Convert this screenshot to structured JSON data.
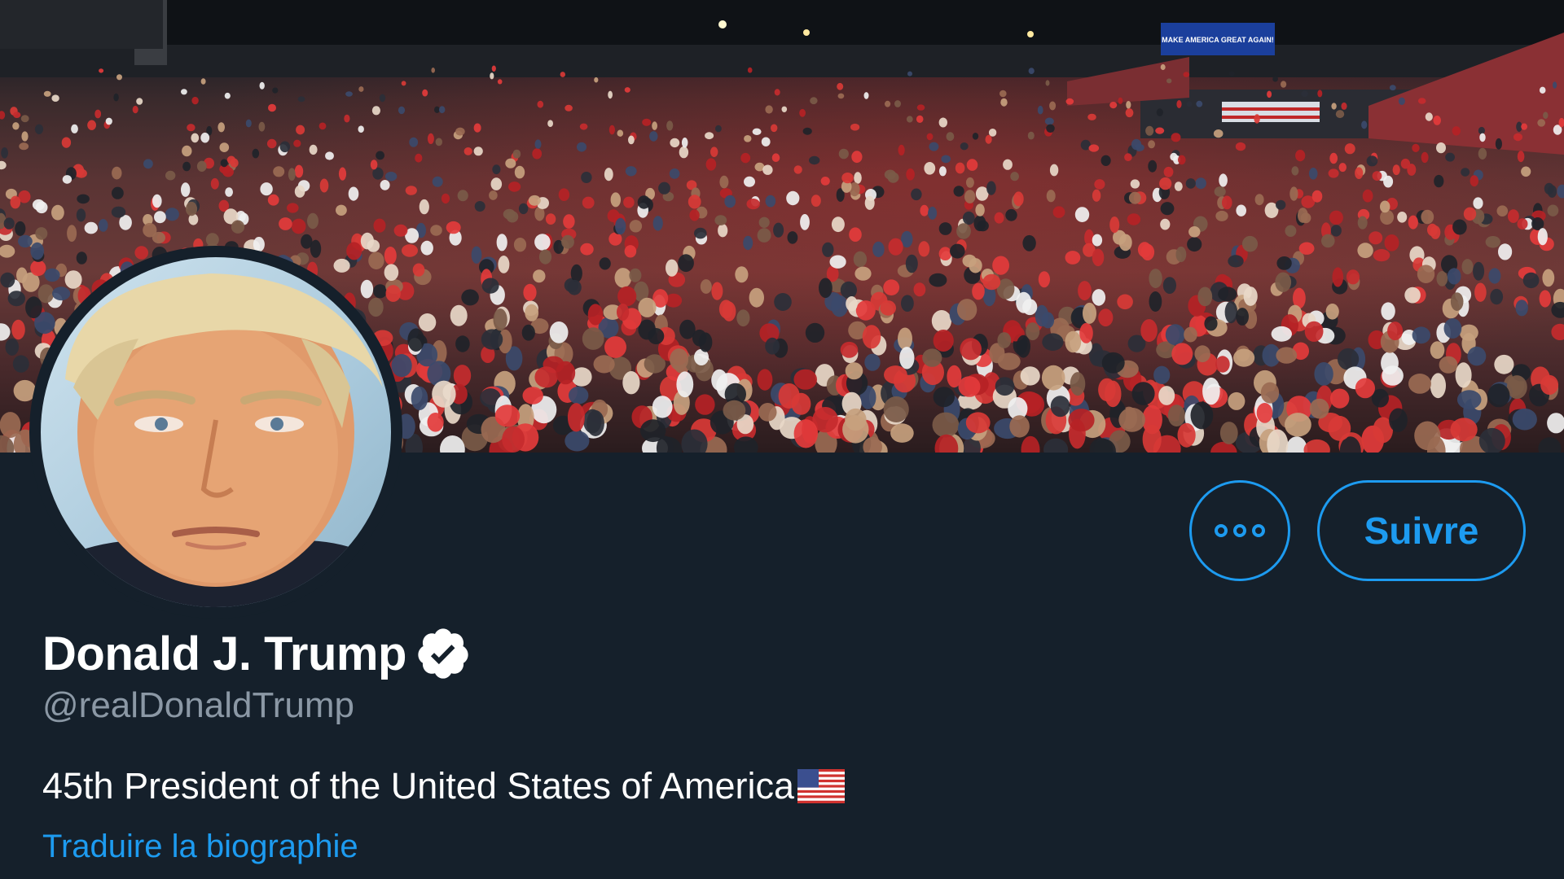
{
  "profile": {
    "display_name": "Donald J. Trump",
    "handle": "@realDonaldTrump",
    "bio": "45th President of the United States of America",
    "bio_emoji": "us-flag-emoji",
    "verified": true,
    "translate_bio_label": "Traduire la biographie"
  },
  "actions": {
    "more_icon": "ellipsis-icon",
    "follow_label": "Suivre"
  },
  "banner": {
    "sign_text": "MAKE AMERICA GREAT AGAIN!"
  },
  "colors": {
    "background": "#15202b",
    "accent": "#1d9bf0",
    "text_primary": "#ffffff",
    "text_secondary": "#8b98a5"
  }
}
